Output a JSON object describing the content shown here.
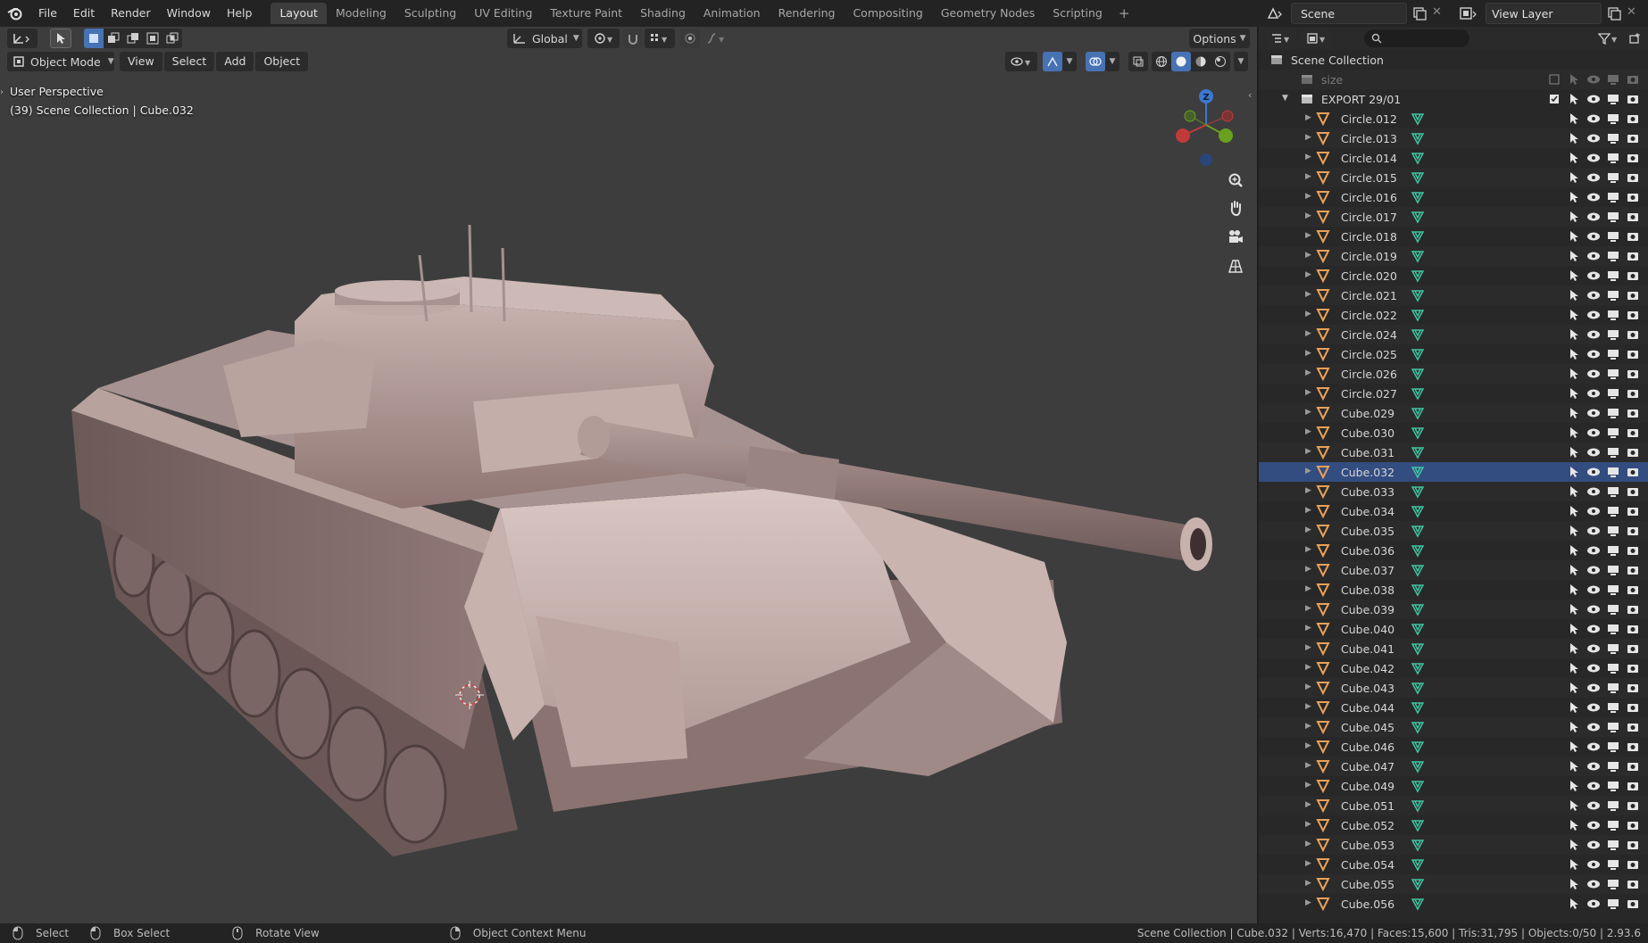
{
  "menu": [
    "File",
    "Edit",
    "Render",
    "Window",
    "Help"
  ],
  "workspaces": [
    "Layout",
    "Modeling",
    "Sculpting",
    "UV Editing",
    "Texture Paint",
    "Shading",
    "Animation",
    "Rendering",
    "Compositing",
    "Geometry Nodes",
    "Scripting"
  ],
  "active_workspace": "Layout",
  "scene": {
    "label": "Scene"
  },
  "view_layer": {
    "label": "View Layer"
  },
  "viewport": {
    "transform_orientation": "Global",
    "options_label": "Options",
    "mode": "Object Mode",
    "menus": [
      "View",
      "Select",
      "Add",
      "Object"
    ],
    "perspective_text": "User Perspective",
    "context_text": "(39) Scene Collection | Cube.032",
    "gizmo_axis_z": "Z"
  },
  "outliner": {
    "search_placeholder": "",
    "scene_collection": "Scene Collection",
    "size_collection": "size",
    "export_collection": "EXPORT 29/01",
    "selected_item": "Cube.032",
    "items": [
      "Circle.012",
      "Circle.013",
      "Circle.014",
      "Circle.015",
      "Circle.016",
      "Circle.017",
      "Circle.018",
      "Circle.019",
      "Circle.020",
      "Circle.021",
      "Circle.022",
      "Circle.024",
      "Circle.025",
      "Circle.026",
      "Circle.027",
      "Cube.029",
      "Cube.030",
      "Cube.031",
      "Cube.032",
      "Cube.033",
      "Cube.034",
      "Cube.035",
      "Cube.036",
      "Cube.037",
      "Cube.038",
      "Cube.039",
      "Cube.040",
      "Cube.041",
      "Cube.042",
      "Cube.043",
      "Cube.044",
      "Cube.045",
      "Cube.046",
      "Cube.047",
      "Cube.049",
      "Cube.051",
      "Cube.052",
      "Cube.053",
      "Cube.054",
      "Cube.055",
      "Cube.056"
    ]
  },
  "statusbar": {
    "select": "Select",
    "box_select": "Box Select",
    "rotate_view": "Rotate View",
    "context_menu": "Object Context Menu",
    "stats": "Scene Collection | Cube.032 | Verts:16,470 | Faces:15,600 | Tris:31,795 | Objects:0/50 | 2.93.6"
  },
  "colors": {
    "accent": "#4772b3",
    "object_orange": "#e8a15a",
    "mesh_green": "#3fc5a0",
    "selected_row": "#334d80"
  }
}
